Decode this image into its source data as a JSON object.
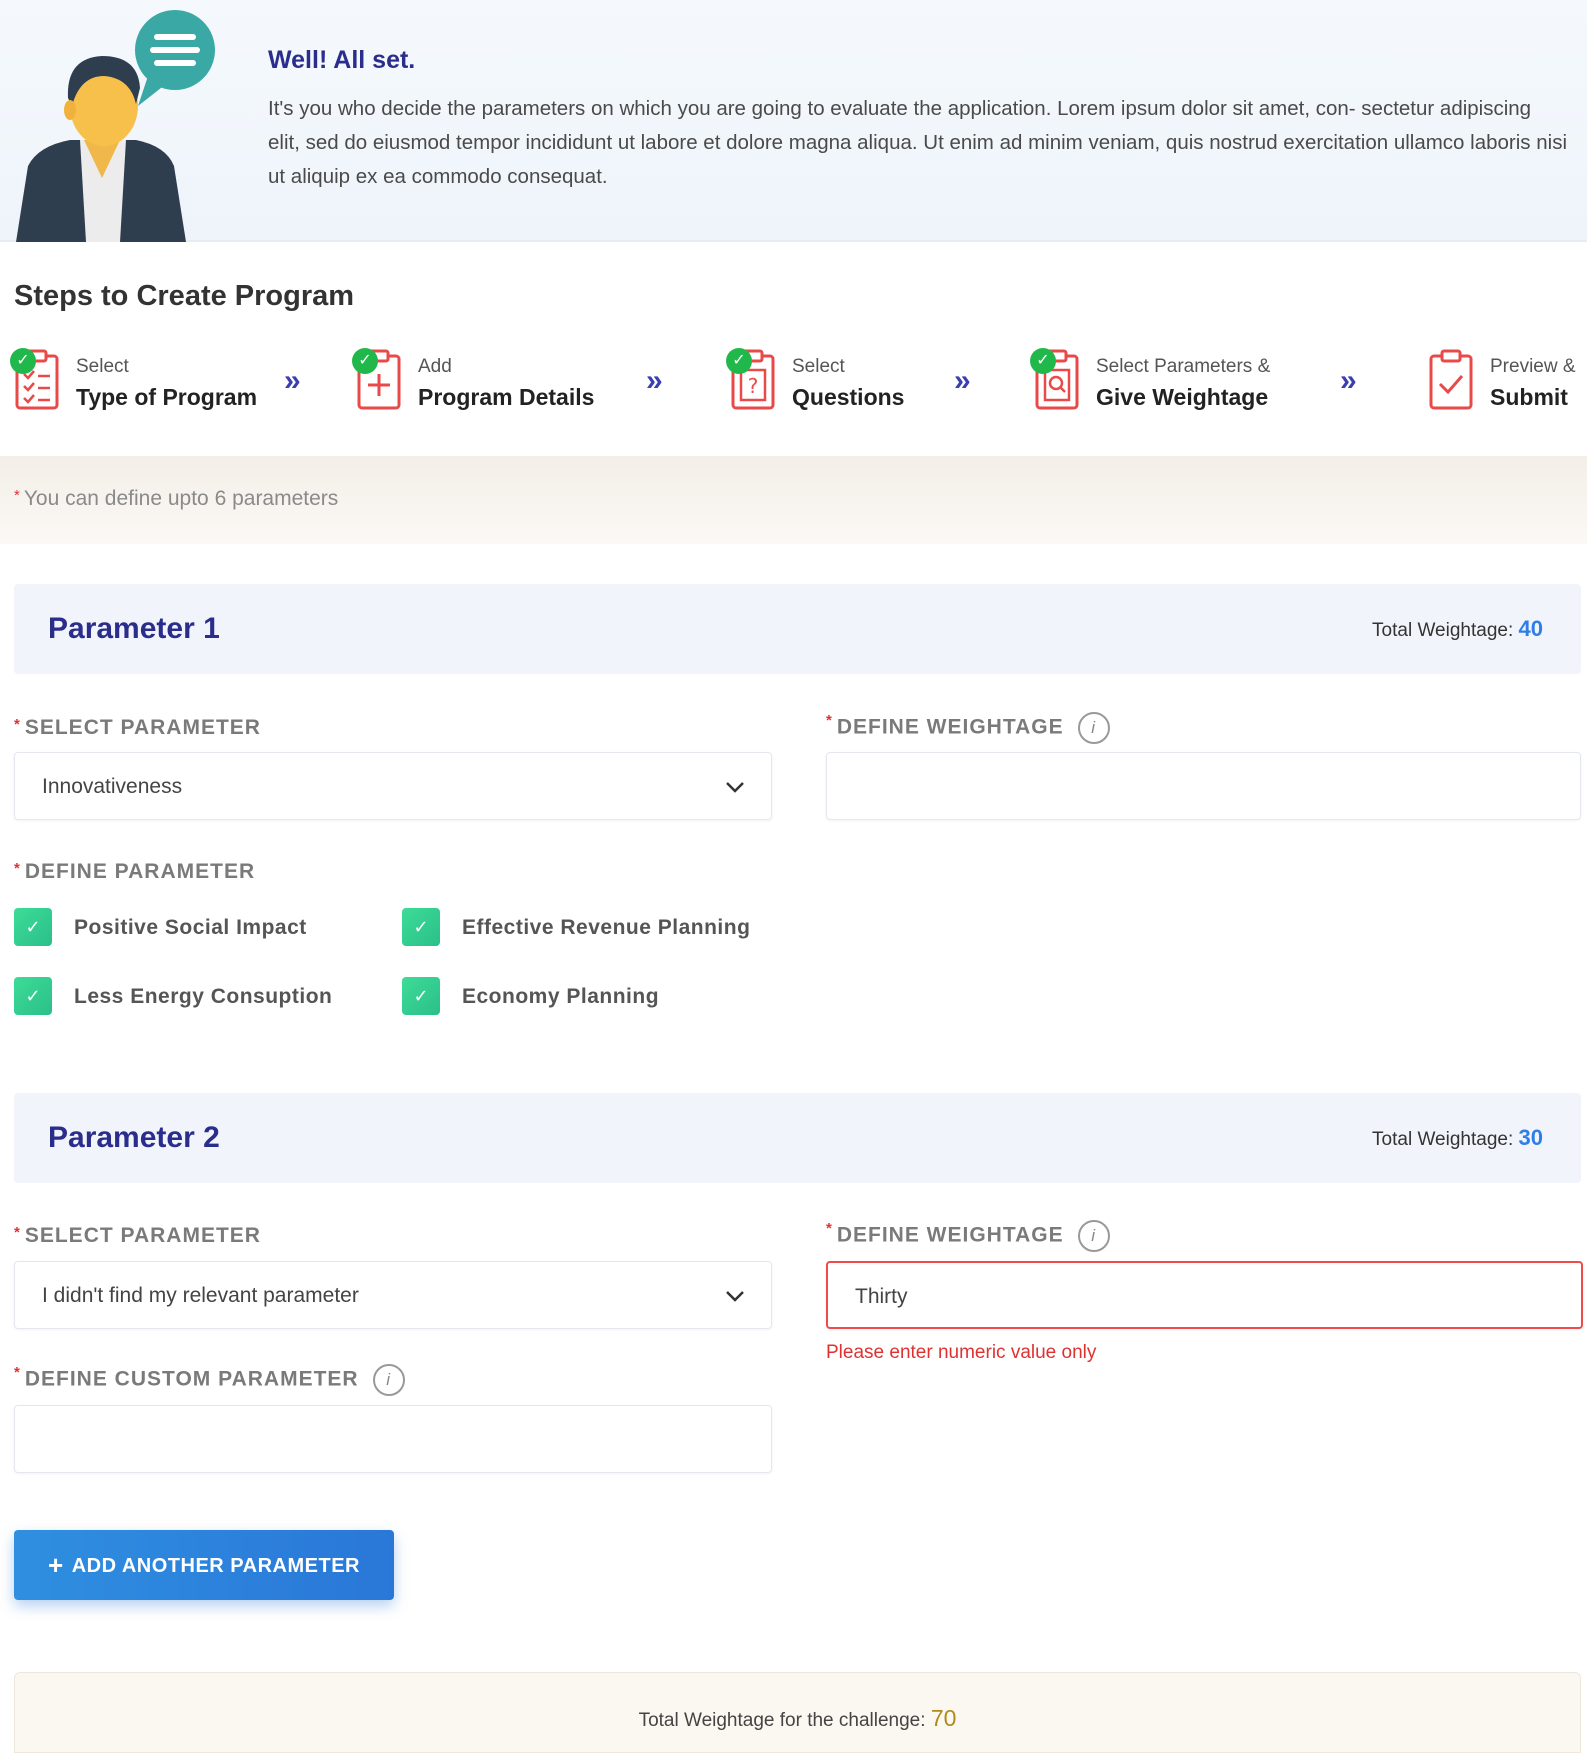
{
  "intro": {
    "title": "Well! All set.",
    "text": "It's you who decide the parameters on which you are going to evaluate the application. Lorem ipsum dolor sit amet, con- sectetur adipiscing elit, sed do eiusmod tempor incididunt ut labore et dolore magna aliqua. Ut enim ad minim veniam, quis nostrud exercitation ullamco laboris nisi ut aliquip ex ea commodo consequat."
  },
  "steps": {
    "title": "Steps to Create Program",
    "items": [
      {
        "line1": "Select",
        "line2": "Type of Program",
        "icon": "checklist-clipboard-icon",
        "completed": true
      },
      {
        "line1": "Add",
        "line2": "Program Details",
        "icon": "add-clipboard-icon",
        "completed": true
      },
      {
        "line1": "Select",
        "line2": "Questions",
        "icon": "question-clipboard-icon",
        "completed": true
      },
      {
        "line1": "Select Parameters &",
        "line2": "Give Weightage",
        "icon": "search-clipboard-icon",
        "completed": true
      },
      {
        "line1": "Preview &",
        "line2": "Submit",
        "icon": "check-clipboard-icon",
        "completed": false
      }
    ],
    "arrow": "»"
  },
  "notice": {
    "required_mark": "*",
    "text": "You can define upto 6 parameters"
  },
  "parameters": [
    {
      "title": "Parameter 1",
      "total_label": "Total Weightage:",
      "total_value": "40",
      "select_label": "SELECT PARAMETER",
      "select_value": "Innovativeness",
      "weight_label": "DEFINE WEIGHTAGE",
      "weight_value": "",
      "define_label": "DEFINE PARAMETER",
      "checkboxes": [
        {
          "label": "Positive Social Impact",
          "checked": true
        },
        {
          "label": "Effective Revenue Planning",
          "checked": true
        },
        {
          "label": "Less Energy Consuption",
          "checked": true
        },
        {
          "label": "Economy Planning",
          "checked": true
        }
      ]
    },
    {
      "title": "Parameter 2",
      "total_label": "Total Weightage:",
      "total_value": "30",
      "select_label": "SELECT PARAMETER",
      "select_value": "I didn't find my relevant parameter",
      "weight_label": "DEFINE WEIGHTAGE",
      "weight_value": "Thirty",
      "weight_error": "Please enter numeric value only",
      "custom_label": "DEFINE CUSTOM PARAMETER",
      "custom_value": ""
    }
  ],
  "add_button": {
    "plus": "+",
    "label": "ADD ANOTHER PARAMETER"
  },
  "footer": {
    "label": "Total Weightage for the challenge:",
    "value": "70"
  },
  "icons": {
    "info": "i",
    "check": "✓",
    "chevron": "chevron-down-icon"
  },
  "colors": {
    "brand_navy": "#2b2d8c",
    "accent_blue": "#2f7ee6",
    "success_green": "#20b84a",
    "checkbox_green": "#3ddc97",
    "error_red": "#e03131",
    "footer_total_gold": "#b08a1c"
  }
}
